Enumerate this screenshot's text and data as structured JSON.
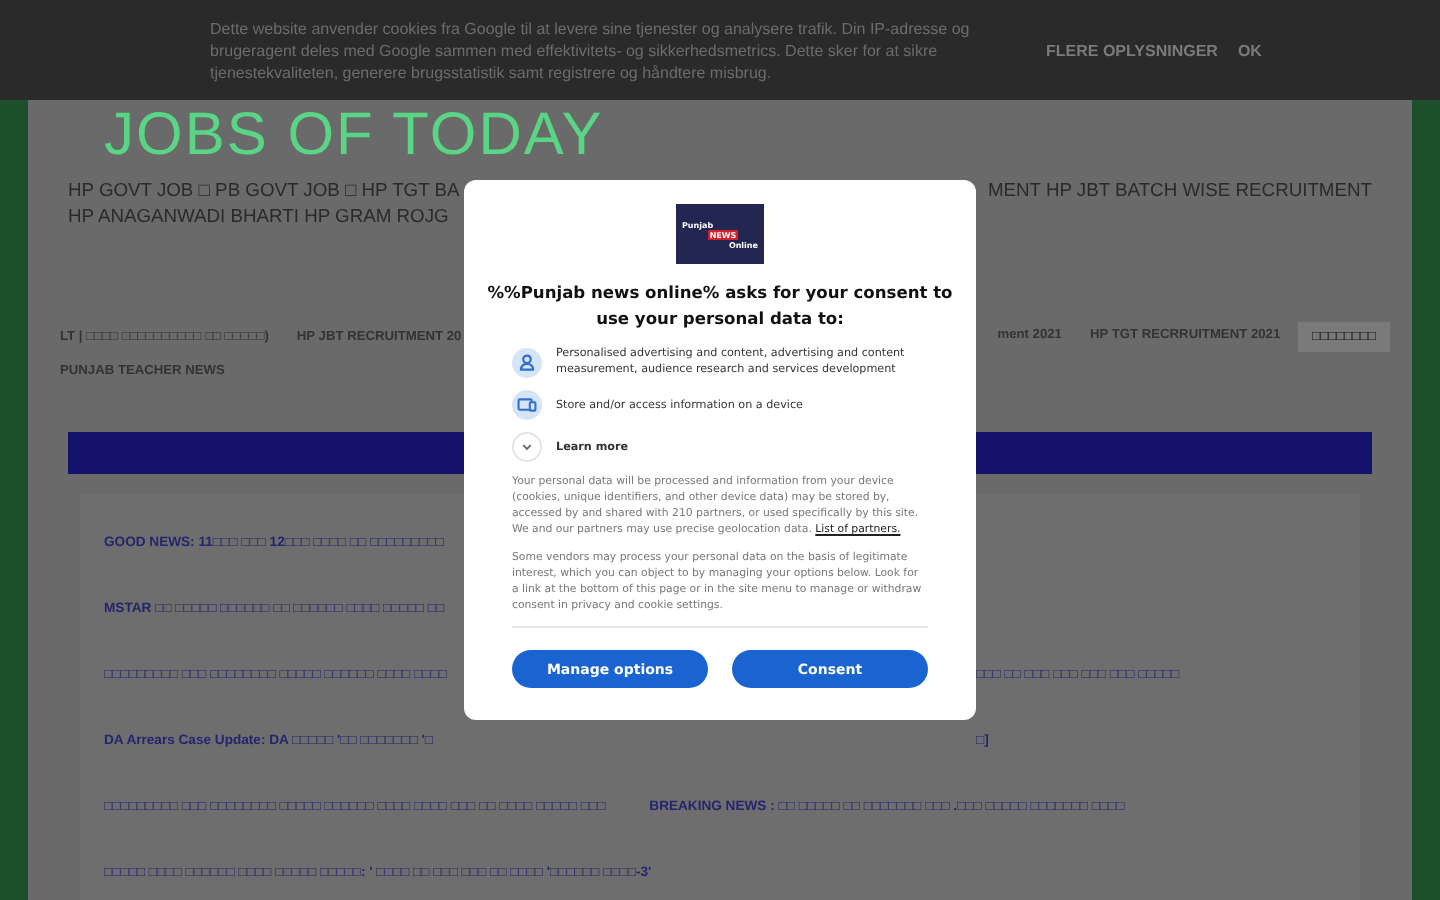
{
  "cookie_bar": {
    "message": "Dette website anvender cookies fra Google til at levere sine tjenester og analysere trafik. Din IP-adresse og brugeragent deles med Google sammen med effektivitets- og sikkerhedsmetrics. Dette sker for at sikre tjenestekvaliteten, generere brugsstatistik samt registrere og håndtere misbrug.",
    "buttons": [
      "FLERE OPLYSNINGER",
      "OK"
    ]
  },
  "site_title": "JOBS OF TODAY",
  "top_links": {
    "line_1_left": "HP GOVT JOB □ PB GOVT JOB □ HP TGT BA",
    "line_1_right": "MENT HP JBT BATCH WISE RECRUITMENT",
    "line_2_left": "HP ANAGANWADI BHARTI HP GRAM ROJG"
  },
  "tabs_left": [
    {
      "label": "LT | □□□□ □□□□□□□□□□ □□ □□□□□)",
      "selected": false
    },
    {
      "label": "HP JBT RECRUITMENT 20",
      "selected": false
    }
  ],
  "tabs_right": [
    {
      "label": "ment 2021",
      "selected": false
    },
    {
      "label": "HP TGT RECRRUITMENT 2021",
      "selected": false
    },
    {
      "label": "□□□□□□□□",
      "selected": true
    }
  ],
  "tabs_second_row": [
    {
      "label": "PUNJAB TEACHER NEWS",
      "selected": false
    }
  ],
  "posts": [
    {
      "parts": [
        "GOOD NEWS: 11□□□ □□□ 12□□□ □□□□ □□ □□□□□□□□□"
      ]
    },
    {
      "parts": [
        "MSTAR □□ □□□□□ □□□□□□ □□ □□□□□□ □□□□ □□□□□ □□"
      ]
    },
    {
      "parts": [
        "□□□□□□□□□ □□□ □□□□□□□□ □□□□□ □□□□□□ □□□□ □□□□",
        "□□□ □□ □□□ □□□ □□□ □□□ □□□□□"
      ]
    },
    {
      "parts": [
        "DA Arrears Case Update: DA □□□□□ '□□ □□□□□□□ '□",
        "□]"
      ]
    },
    {
      "parts": [
        "□□□□□□□□□ □□□ □□□□□□□□ □□□□□ □□□□□□ □□□□ □□□□ □□□ □□ □□□□ □□□□□ □□□"
      ],
      "second": "BREAKING NEWS : □□ □□□□□ □□ □□□□□□□ □□□ .□□□ □□□□□ □□□□□□□ □□□□"
    },
    {
      "parts": [
        "□□□□□ □□□□ □□□□□□ □□□□ □□□□□ □□□□□: ' □□□□ □□ □□□ □□□ □□ □□□□ '□□□□□□ □□□□-3'"
      ]
    }
  ],
  "consent_dialog": {
    "logo": {
      "line_1": "Punjab",
      "line_2": "NEWS",
      "line_3": "Online"
    },
    "heading": "%%Punjab news online% asks for your consent to use your personal data to:",
    "purposes": [
      {
        "kind": "person",
        "text": "Personalised advertising and content, advertising and content measurement, audience research and services development"
      },
      {
        "kind": "device",
        "text": "Store and/or access information on a device"
      }
    ],
    "learn_more": {
      "label": "Learn more",
      "expanded": false
    },
    "paragraph_1": "Your personal data will be processed and information from your device (cookies, unique identifiers, and other device data) may be stored by, accessed by and shared with 210 partners, or used specifically by this site. We and our partners may use precise geolocation data.",
    "partners_link": "List of partners.",
    "paragraph_2": "Some vendors may process your personal data on the basis of legitimate interest, which you can object to by managing your options below. Look for a link at the bottom of this page or in the site menu to manage or withdraw consent in privacy and cookie settings.",
    "buttons": [
      "Manage options",
      "Consent"
    ]
  }
}
